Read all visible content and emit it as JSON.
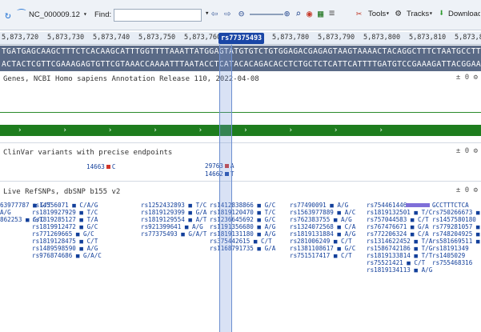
{
  "toolbar": {
    "accession": "NC_000009.12",
    "find_label": "Find:",
    "find_value": "",
    "tools_label": "Tools",
    "tracks_label": "Tracks",
    "download_label": "Download"
  },
  "ruler": {
    "labels": [
      "5,873,720",
      "5,873,730",
      "5,873,740",
      "5,873,750",
      "5,873,760",
      "5,873,780",
      "5,873,790",
      "5,873,800",
      "5,873,810",
      "5,873,820"
    ],
    "position": "rs77375493"
  },
  "sequence": {
    "forward": "TGATGAGCAAGCTTTCTCACAAGCATTTGGTTTTAAATTATGGAGTATGTGTCTGTGGAGACGAGAGTAAGTAAAACTACAGGCTTTCTAATGCCTTTCTCAGAGCATCT",
    "reverse": "ACTACTCGTTCGAAAGAGTGTTCGTAAACCAAAATTTAATACCTCATACACAGACACCTCTGCTCTCATTCATTTTGATGTCCGAAAGATTACGGAAAGAGTCTCGTAGA"
  },
  "tracks": {
    "genes_title": "Genes, NCBI Homo sapiens Annotation Release 110, 2022-04-08",
    "clinvar_title": "ClinVar variants with precise endpoints",
    "clinvar_items": [
      "14663",
      "C",
      "29763",
      "A",
      "14662",
      "T"
    ],
    "snp_title": "Live RefSNPs, dbSNP b155 v2",
    "track_icons": "± 0 ⚙"
  },
  "snps": {
    "col1": [
      "63977787 ■ G/T",
      "A/G",
      "862253 ■ G/C"
    ],
    "c2": [
      "rs14556071 ■ C/A/G",
      "rs1819927929 ■ T/C",
      "rs1819285127 ■ T/A",
      "rs1819912472 ■ G/C",
      "rs771269665 ■ G/C",
      "rs1819128475 ■ C/T",
      "rs1489598590 ■ A/G",
      "rs976874686 ■ G/A/C"
    ],
    "c3": [
      "rs1252432893 ■ T/C",
      "rs1819129399 ■ G/A",
      "rs1819129554 ■ A/T",
      "rs921399641 ■ A/G",
      "rs77375493 ■ G/A/T"
    ],
    "c4": [
      "rs1412838866 ■ G/C",
      "rs1819120470 ■ T/C",
      "rs1236645692 ■ G/C",
      "rs1191356680 ■ A/G",
      "rs1819131180 ■ A/G",
      "rs375442615 ■ C/T",
      "rs1168791735 ■ G/A"
    ],
    "c5": [
      "rs77490091 ■ A/G",
      "rs1563977889 ■ A/C",
      "rs762383755 ■ A/G",
      "rs1324072568 ■ C/A",
      "rs1819131884 ■ A/G",
      "rs281006249 ■ C/T",
      "rs1381108617 ■ G/C",
      "rs751517417 ■ C/T"
    ],
    "c6": [
      "rs754461446",
      "rs1819132501 ■ T/C",
      "rs757044583 ■ C/T",
      "rs767476671 ■ G/A",
      "rs772206324 ■ C/A",
      "rs1314622452 ■ T/A",
      "rs1586742186 ■ T/G",
      "rs1819133814 ■ T/T",
      "rs75521421 ■ C/T",
      "rs1819134113 ■ A/G"
    ],
    "c7": [
      "GCCTTTCTCA",
      "rs750266673 ■ C/G",
      "rs1457580180",
      "rs779281057 ■ C/G/T",
      "rs748204925 ■ A/G",
      "rs581669511 ■ C",
      "rs18191349",
      "rs1405029",
      "rs755468316"
    ]
  },
  "colors": {
    "gene_band": "#1e7d1e",
    "seq_bg": "#5a6a86",
    "snp_marker": "#d0362b",
    "accent": "#1a46a6"
  }
}
